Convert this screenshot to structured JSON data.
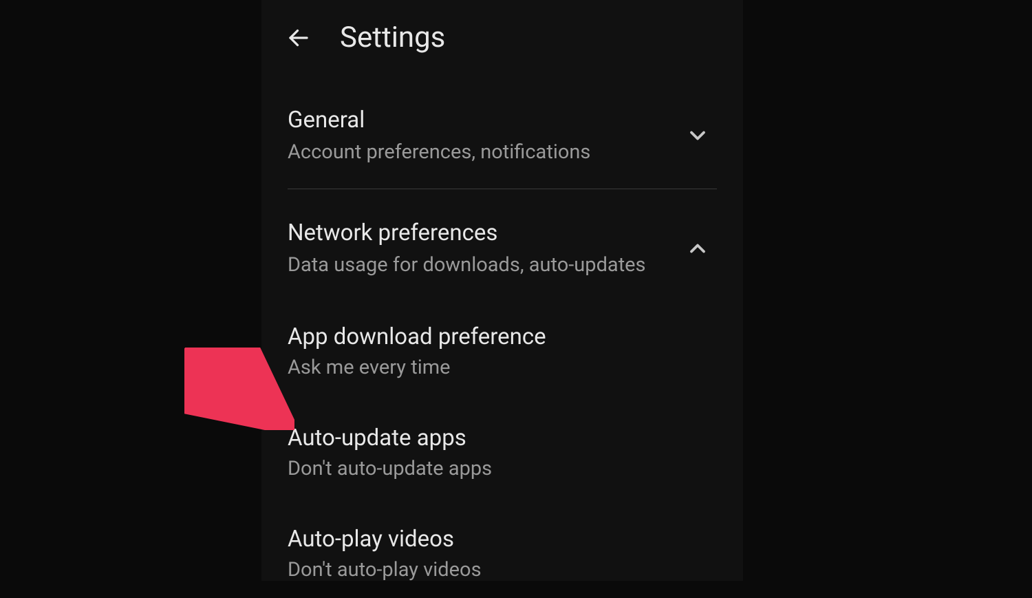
{
  "header": {
    "title": "Settings"
  },
  "sections": {
    "general": {
      "title": "General",
      "subtitle": "Account preferences, notifications",
      "expanded": false
    },
    "network": {
      "title": "Network preferences",
      "subtitle": "Data usage for downloads, auto-updates",
      "expanded": true
    }
  },
  "settings": {
    "app_download": {
      "title": "App download preference",
      "value": "Ask me every time"
    },
    "auto_update": {
      "title": "Auto-update apps",
      "value": "Don't auto-update apps"
    },
    "auto_play": {
      "title": "Auto-play videos",
      "value": "Don't auto-play videos"
    }
  }
}
